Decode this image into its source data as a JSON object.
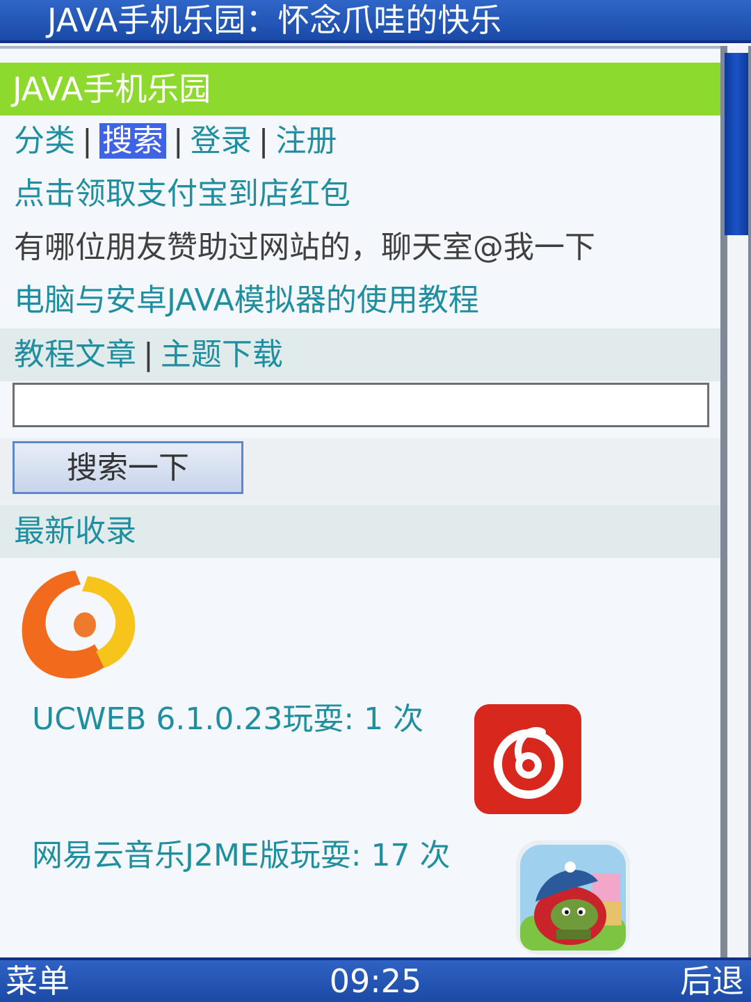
{
  "window": {
    "title": "JAVA手机乐园：怀念爪哇的快乐"
  },
  "site": {
    "header": "JAVA手机乐园"
  },
  "nav": {
    "items": [
      "分类",
      "搜索",
      "登录",
      "注册"
    ],
    "separator": "|",
    "selected": "搜索"
  },
  "links": {
    "promo": "点击领取支付宝到店红包",
    "notice": "有哪位朋友赞助过网站的，聊天室@我一下",
    "tutorial": "电脑与安卓JAVA模拟器的使用教程"
  },
  "sections": {
    "articles": "教程文章",
    "themes": "主题下载",
    "latest": "最新收录"
  },
  "search": {
    "value": "",
    "button_label": "搜索一下"
  },
  "apps": [
    {
      "name": "UCWEB 6.1.0.23",
      "suffix": "玩耍: 1 次",
      "icon": "ucweb-logo-icon"
    },
    {
      "name": "网易云音乐J2ME版",
      "suffix": "玩耍: 17 次",
      "icon": "netease-music-logo-icon"
    },
    {
      "name": "",
      "suffix": "",
      "icon": "angry-birds-icon"
    }
  ],
  "softkeys": {
    "left": "菜单",
    "center": "09:25",
    "right": "后退"
  },
  "colors": {
    "titlebar": "#1a4aa8",
    "site_header": "#8ed92e",
    "link": "#1f8fa0",
    "selected_bg": "#3e63e6",
    "section_bg": "#e2ebeb"
  }
}
